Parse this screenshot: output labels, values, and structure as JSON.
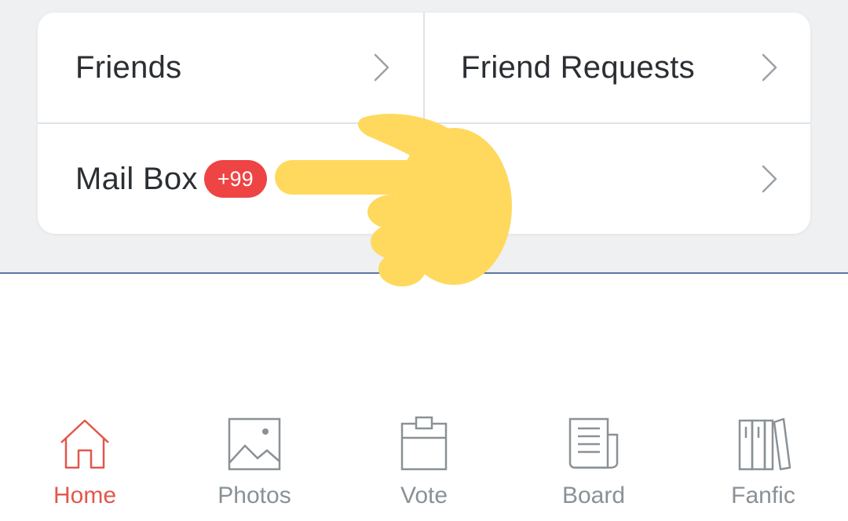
{
  "menu": {
    "friends_label": "Friends",
    "friend_requests_label": "Friend Requests",
    "mailbox_label": "Mail Box",
    "mailbox_badge": "+99"
  },
  "nav": {
    "items": [
      {
        "label": "Home",
        "icon": "home-icon",
        "active": true
      },
      {
        "label": "Photos",
        "icon": "photo-icon",
        "active": false
      },
      {
        "label": "Vote",
        "icon": "clipboard-icon",
        "active": false
      },
      {
        "label": "Board",
        "icon": "newspaper-icon",
        "active": false
      },
      {
        "label": "Fanfic",
        "icon": "books-icon",
        "active": false
      }
    ]
  },
  "colors": {
    "accent": "#e2574c",
    "badge": "#ee4444",
    "inactive_nav": "#8a9196",
    "background": "#eef0f2",
    "pointer_overlay": "#ffd95e"
  }
}
